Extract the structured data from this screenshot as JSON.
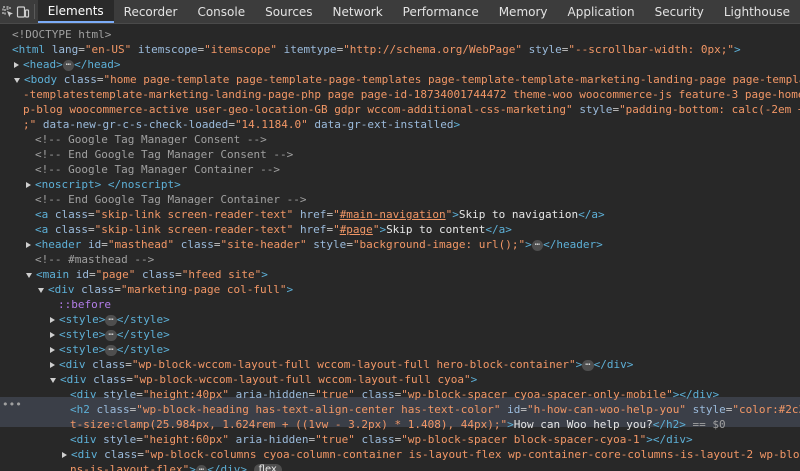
{
  "toolbar": {
    "tabs": [
      "Elements",
      "Recorder",
      "Console",
      "Sources",
      "Network",
      "Performance",
      "Memory",
      "Application",
      "Security",
      "Lighthouse"
    ],
    "active": "Elements",
    "icons": [
      "inspect-element-icon",
      "device-toolbar-icon"
    ]
  },
  "tree": {
    "doctype": "<!DOCTYPE html>",
    "html_lang": "\"en-US\"",
    "html_itemscope": "\"itemscope\"",
    "html_itemtype": "\"http://schema.org/WebPage\"",
    "html_style": "\"--scrollbar-width: 0px;\"",
    "body_class_1": "\"home page-template page-template-page-templates page-template-template-marketing-landing-page page-template-page-",
    "body_class_2": "-templatestemplate-marketing-landing-page-php page page-id-18734001744472 theme-woo woocommerce-js feature-3 page-home-2 group",
    "body_class_3": "p-blog woocommerce-active user-geo-location-GB gdpr wccom-additional-css-marketing\"",
    "body_style": "\"padding-bottom: calc(-2em + 282px)",
    "body_line4_start": ";\"",
    "body_check": "\"14.1184.0\"",
    "body_line4_end": "data-gr-ext-installed",
    "comment_1": "<!-- Google Tag Manager Consent -->",
    "comment_2": "<!-- End Google Tag Manager Consent -->",
    "comment_3": "<!-- Google Tag Manager Container -->",
    "comment_4": "<!-- End Google Tag Manager Container -->",
    "link1_class": "\"skip-link screen-reader-text\"",
    "link1_href": "#main-navigation",
    "link1_text": "Skip to navigation",
    "link2_class": "\"skip-link screen-reader-text\"",
    "link2_href": "#page",
    "link2_text": "Skip to content",
    "header_id": "\"masthead\"",
    "header_class": "\"site-header\"",
    "header_style": "\"background-image: url();\"",
    "comment_5": "<!-- #masthead -->",
    "main_id": "\"page\"",
    "main_class": "\"hfeed site\"",
    "div1_class": "\"marketing-page col-full\"",
    "pseudo": "::before",
    "div2_class": "\"wp-block-wccom-layout-full wccom-layout-full hero-block-container\"",
    "div3_class": "\"wp-block-wccom-layout-full wccom-layout-full cyoa\"",
    "spacer1_style": "\"height:40px\"",
    "spacer1_aria": "\"true\"",
    "spacer1_class": "\"wp-block-spacer cyoa-spacer-only-mobile\"",
    "h2_class": "\"wp-block-heading has-text-align-center has-text-color\"",
    "h2_id": "\"h-how-can-woo-help-you\"",
    "h2_style_1": "\"color:#2c3338;fon",
    "h2_style_2": "t-size:clamp(25.984px, 1.624rem + ((1vw - 3.2px) * 1.408), 44px);\"",
    "h2_text": "How can Woo help you?",
    "h2_marker": "== $0",
    "spacer2_style": "\"height:60px\"",
    "spacer2_aria": "\"true\"",
    "spacer2_class": "\"wp-block-spacer block-spacer-cyoa-1\"",
    "cols_class_1": "\"wp-block-columns cyoa-column-container is-layout-flex wp-container-core-columns-is-layout-2 wp-block-column",
    "cols_class_2": "ns-is-layout-flex\"",
    "flex_badge": "flex",
    "ellipsis": "⋯",
    "row_dots": "•••"
  }
}
